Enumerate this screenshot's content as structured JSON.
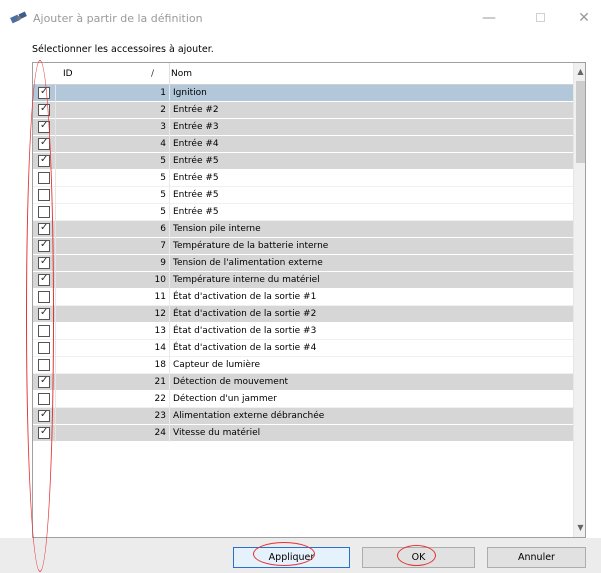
{
  "window": {
    "title": "Ajouter à partir de la définition",
    "minimize": "—",
    "close": "✕",
    "icon": "satellite-icon"
  },
  "instructions": "Sélectionner les accessoires à ajouter.",
  "grid": {
    "columns": {
      "id": "ID",
      "sort_indicator": "/",
      "name": "Nom"
    },
    "rows": [
      {
        "checked": true,
        "selected": true,
        "id": "1",
        "name": "Ignition"
      },
      {
        "checked": true,
        "selected": false,
        "id": "2",
        "name": "Entrée #2"
      },
      {
        "checked": true,
        "selected": false,
        "id": "3",
        "name": "Entrée #3"
      },
      {
        "checked": true,
        "selected": false,
        "id": "4",
        "name": "Entrée #4"
      },
      {
        "checked": true,
        "selected": false,
        "id": "5",
        "name": "Entrée #5"
      },
      {
        "checked": false,
        "selected": false,
        "id": "5",
        "name": "Entrée #5"
      },
      {
        "checked": false,
        "selected": false,
        "id": "5",
        "name": "Entrée #5"
      },
      {
        "checked": false,
        "selected": false,
        "id": "5",
        "name": "Entrée #5"
      },
      {
        "checked": true,
        "selected": false,
        "id": "6",
        "name": "Tension pile interne"
      },
      {
        "checked": true,
        "selected": false,
        "id": "7",
        "name": "Température de la batterie interne"
      },
      {
        "checked": true,
        "selected": false,
        "id": "9",
        "name": "Tension de l'alimentation externe"
      },
      {
        "checked": true,
        "selected": false,
        "id": "10",
        "name": "Température interne du matériel"
      },
      {
        "checked": false,
        "selected": false,
        "id": "11",
        "name": "État d'activation de la sortie #1"
      },
      {
        "checked": true,
        "selected": false,
        "id": "12",
        "name": "État d'activation de la sortie #2"
      },
      {
        "checked": false,
        "selected": false,
        "id": "13",
        "name": "État d'activation de la sortie #3"
      },
      {
        "checked": false,
        "selected": false,
        "id": "14",
        "name": "État d'activation de la sortie #4"
      },
      {
        "checked": false,
        "selected": false,
        "id": "18",
        "name": "Capteur de lumière"
      },
      {
        "checked": true,
        "selected": false,
        "id": "21",
        "name": "Détection de mouvement"
      },
      {
        "checked": false,
        "selected": false,
        "id": "22",
        "name": "Détection d'un jammer"
      },
      {
        "checked": true,
        "selected": false,
        "id": "23",
        "name": "Alimentation externe débranchée"
      },
      {
        "checked": true,
        "selected": false,
        "id": "24",
        "name": "Vitesse du matériel"
      }
    ]
  },
  "buttons": {
    "apply": "Appliquer",
    "ok": "OK",
    "cancel": "Annuler"
  },
  "colors": {
    "checked_row": "#d6d6d6",
    "selected_row": "#b3c7da",
    "annotation": "#e53232",
    "apply_border": "#2a6fc9"
  }
}
